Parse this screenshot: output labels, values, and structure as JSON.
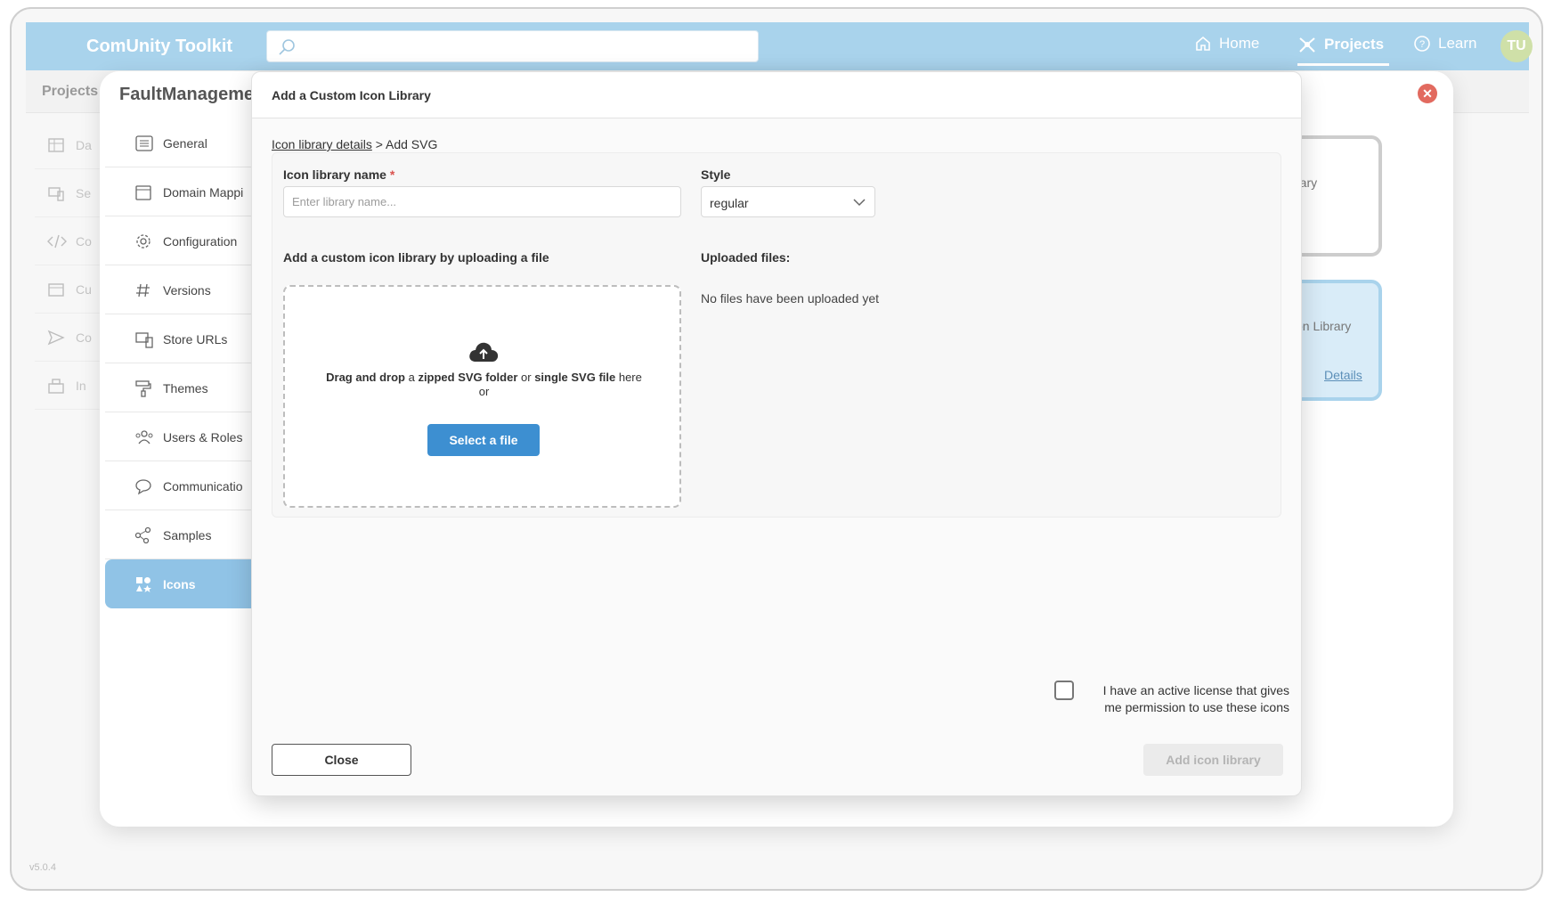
{
  "app": {
    "brand": "ComUnity Toolkit",
    "nav": {
      "home": "Home",
      "projects": "Projects",
      "learn": "Learn"
    },
    "avatar_initials": "TU",
    "version": "v5.0.4"
  },
  "background": {
    "projects_label": "Projects",
    "side_items": [
      "Da",
      "Se",
      "Co",
      "Cu",
      "Co",
      "In"
    ],
    "card1_text": "rary",
    "card2_text": "on Library",
    "card2_link": "Details"
  },
  "project": {
    "title": "FaultManageme",
    "sidebar": [
      {
        "label": "General",
        "icon": "list-icon"
      },
      {
        "label": "Domain Mappi",
        "icon": "calendar-icon"
      },
      {
        "label": "Configuration",
        "icon": "gear-icon"
      },
      {
        "label": "Versions",
        "icon": "hash-icon"
      },
      {
        "label": "Store URLs",
        "icon": "devices-icon"
      },
      {
        "label": "Themes",
        "icon": "paint-roller-icon"
      },
      {
        "label": "Users & Roles",
        "icon": "users-icon"
      },
      {
        "label": "Communicatio",
        "icon": "chat-icon"
      },
      {
        "label": "Samples",
        "icon": "share-icon"
      },
      {
        "label": "Icons",
        "icon": "icons-icon",
        "active": true
      }
    ]
  },
  "modal": {
    "title": "Add a Custom Icon Library",
    "breadcrumb_link": "Icon library details",
    "breadcrumb_current": "> Add SVG",
    "name_label": "Icon library name",
    "name_required": "*",
    "name_placeholder": "Enter library name...",
    "style_label": "Style",
    "style_value": "regular",
    "upload_label": "Add a custom icon library by uploading a file",
    "uploaded_label": "Uploaded files:",
    "uploaded_empty": "No files have been uploaded yet",
    "dropzone": {
      "p1": "Drag and drop",
      "p2": " a ",
      "p3": "zipped SVG folder",
      "p4": " or ",
      "p5": "single SVG file",
      "p6": " here",
      "or": "or",
      "button": "Select a file"
    },
    "license_text": "I have an active license that gives me permission to use these icons",
    "close_button": "Close",
    "add_button": "Add icon library"
  }
}
